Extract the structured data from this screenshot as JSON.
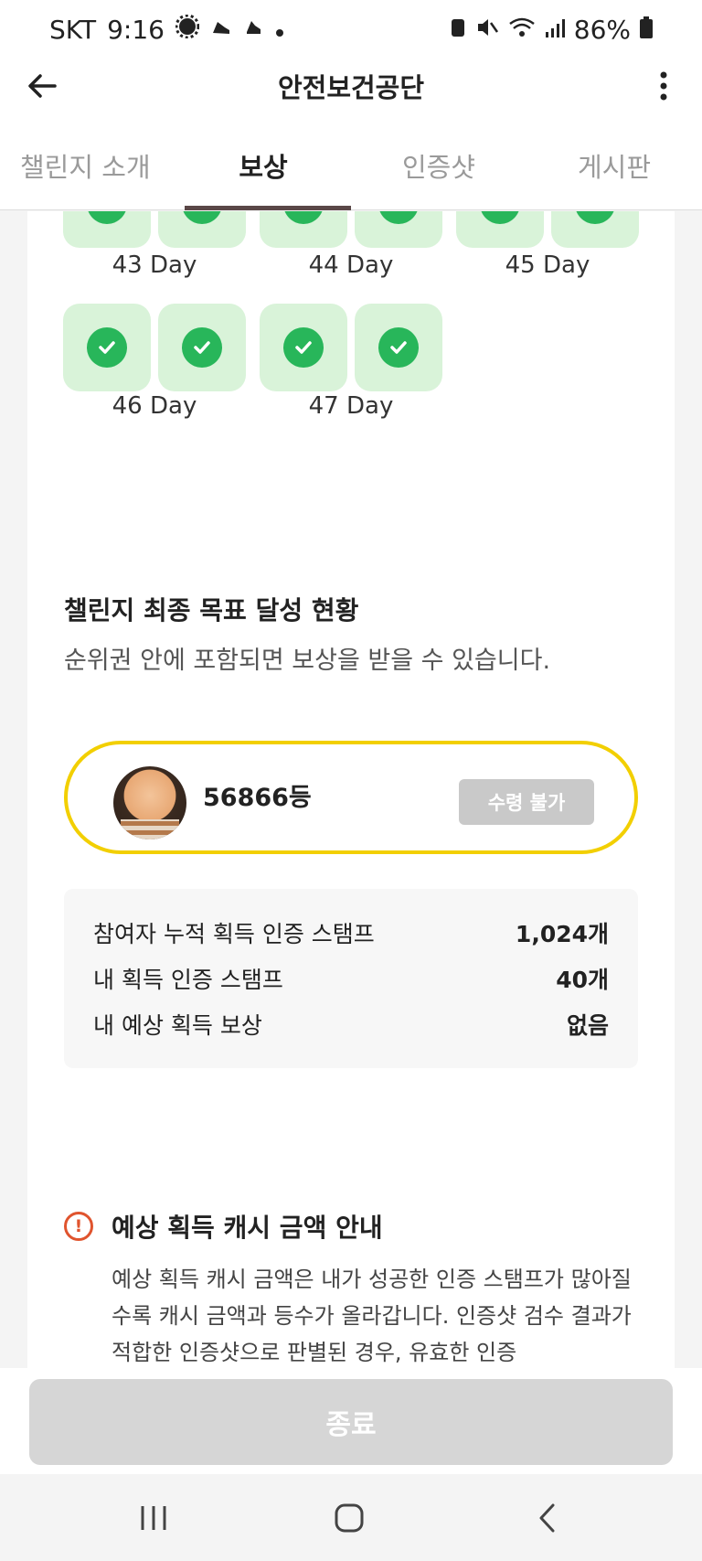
{
  "status_bar": {
    "carrier": "SKT",
    "time": "9:16",
    "battery": "86%"
  },
  "app_bar": {
    "title": "안전보건공단"
  },
  "tabs": [
    {
      "label": "챌린지 소개",
      "active": false
    },
    {
      "label": "보상",
      "active": true
    },
    {
      "label": "인증샷",
      "active": false
    },
    {
      "label": "게시판",
      "active": false
    }
  ],
  "stamp_days": [
    "43 Day",
    "44 Day",
    "45 Day",
    "46 Day",
    "47 Day"
  ],
  "goal_card": {
    "title": "챌린지 최종 목표 달성 현황",
    "subtitle": "순위권 안에 포함되면 보상을 받을 수 있습니다.",
    "rank": "56866등",
    "receive_label": "수령 불가",
    "stats": [
      {
        "label": "참여자 누적 획득 인증 스탬프",
        "value": "1,024개"
      },
      {
        "label": "내 획득 인증 스탬프",
        "value": "40개"
      },
      {
        "label": "내 예상 획득 보상",
        "value": "없음"
      }
    ]
  },
  "notice_card": {
    "title": "예상 획득 캐시 금액 안내",
    "body": "예상 획득 캐시 금액은 내가 성공한 인증 스탬프가 많아질수록 캐시 금액과 등수가 올라갑니다. 인증샷 검수 결과가 적합한 인증샷으로 판별된 경우, 유효한 인증"
  },
  "bottom_button": {
    "label": "종료"
  },
  "colors": {
    "accent_yellow": "#f2cf00",
    "stamp_green": "#28b65a",
    "warning_red": "#e0542e",
    "tab_indicator": "#5a4747"
  }
}
